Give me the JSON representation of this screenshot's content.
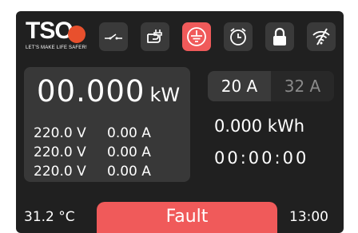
{
  "brand": {
    "logo_text": "TSO",
    "tagline": "LET'S MAKE LIFE SAFER!",
    "accent_color": "#e8502d"
  },
  "status_icons": [
    {
      "name": "switch-icon",
      "active": false
    },
    {
      "name": "hand-plug-icon",
      "active": false
    },
    {
      "name": "ground-icon",
      "active": true
    },
    {
      "name": "alarm-clock-icon",
      "active": false
    },
    {
      "name": "lock-icon",
      "active": false
    },
    {
      "name": "no-wifi-icon",
      "active": false
    }
  ],
  "power": {
    "value": "00.000",
    "unit": "kW"
  },
  "phases": [
    {
      "voltage": "220.0 V",
      "current": "0.00 A"
    },
    {
      "voltage": "220.0 V",
      "current": "0.00 A"
    },
    {
      "voltage": "220.0 V",
      "current": "0.00 A"
    }
  ],
  "current_limit": {
    "options": [
      "20 A",
      "32 A"
    ],
    "selected": "20 A"
  },
  "energy": "0.000 kWh",
  "session_time": "00:00:00",
  "temperature": "31.2 °C",
  "status": {
    "label": "Fault",
    "color": "#f05a5a"
  },
  "clock": "13:00"
}
